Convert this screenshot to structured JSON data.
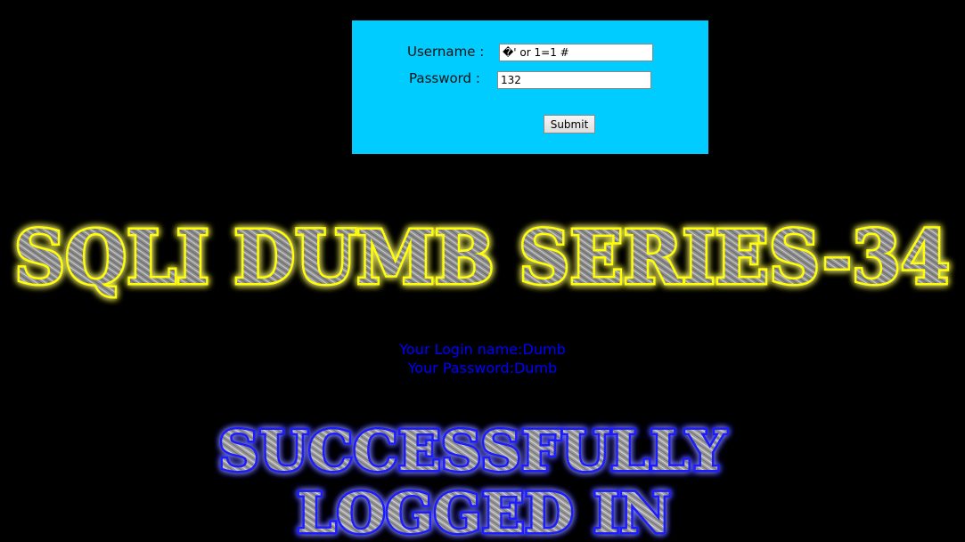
{
  "form": {
    "username_label": "Username :",
    "username_value": "�' or 1=1 #",
    "password_label": "Password :",
    "password_value": "132",
    "submit_label": "Submit",
    "panel_color": "#00CCFF"
  },
  "banner": {
    "title": "SQLI DUMB SERIES-34",
    "glow_color": "#FFFF00"
  },
  "result": {
    "login_name": "Your Login name:Dumb",
    "password": "Your Password:Dumb",
    "text_color": "#0000FF"
  },
  "success": {
    "line1": "SUCCESSFULLY",
    "line2": "LOGGED IN",
    "glow_color": "#0000FF"
  }
}
